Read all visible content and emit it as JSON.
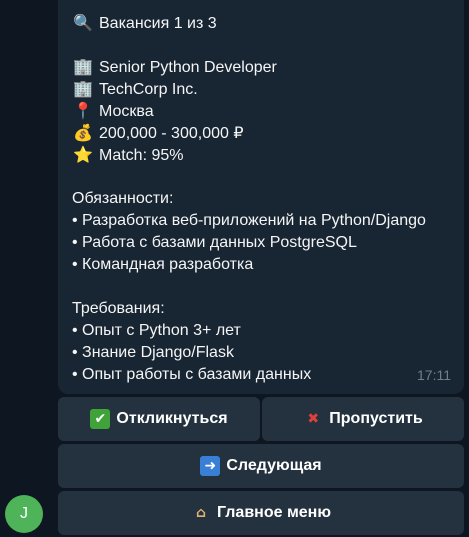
{
  "message": {
    "header": {
      "icon": "magnifier-icon",
      "text": "Вакансия 1 из 3"
    },
    "position": {
      "icon": "office-building-icon",
      "text": "Senior Python Developer"
    },
    "company": {
      "icon": "office-building-icon",
      "text": "TechCorp Inc."
    },
    "location": {
      "icon": "location-pin-icon",
      "text": "Москва"
    },
    "salary": {
      "icon": "money-bag-icon",
      "text": "200,000 - 300,000 ₽"
    },
    "match": {
      "icon": "star-icon",
      "text": "Match: 95%"
    },
    "duties_title": "Обязанности:",
    "duties": [
      "• Разработка веб-приложений на Python/Django",
      "• Работа с базами данных PostgreSQL",
      "• Командная разработка"
    ],
    "requirements_title": "Требования:",
    "requirements": [
      "• Опыт с Python 3+ лет",
      "• Знание Django/Flask",
      "• Опыт работы с базами данных"
    ],
    "time": "17:11"
  },
  "keyboard": {
    "respond": {
      "icon": "check-mark-icon",
      "label": "Откликнуться"
    },
    "skip": {
      "icon": "cross-mark-icon",
      "label": "Пропустить"
    },
    "next": {
      "icon": "right-arrow-icon",
      "label": "Следующая"
    },
    "menu": {
      "icon": "house-icon",
      "label": "Главное меню"
    }
  },
  "avatar": {
    "letter": "J",
    "color": "#4fb35a"
  }
}
